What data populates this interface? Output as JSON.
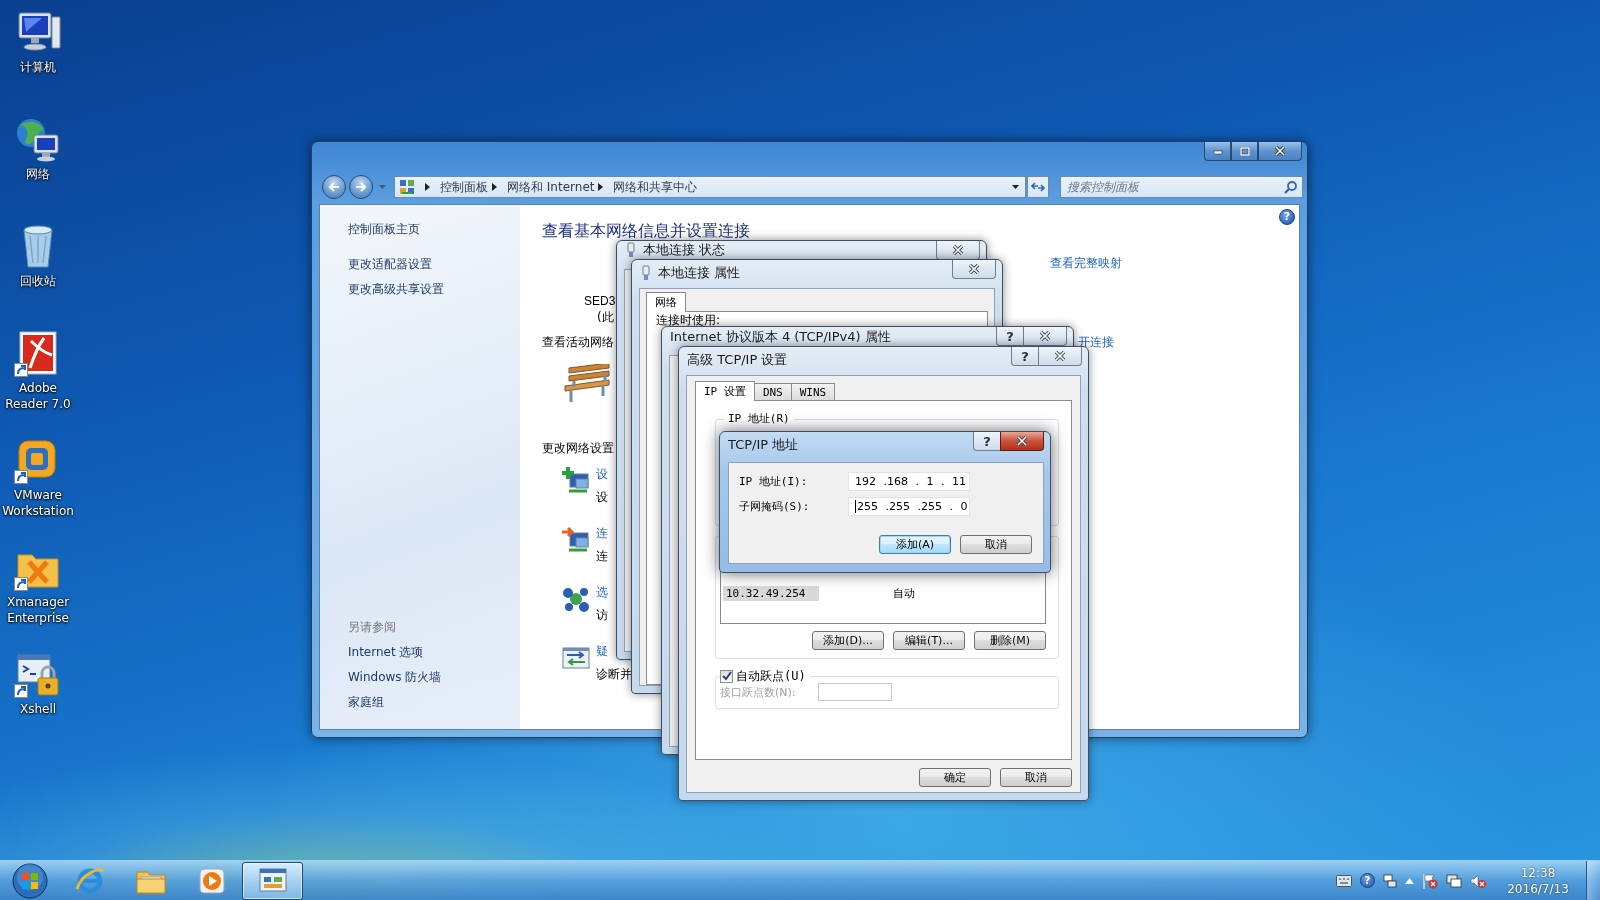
{
  "desktop_icons": [
    {
      "kind": "computer",
      "label": "计算机",
      "shortcut": false
    },
    {
      "kind": "network",
      "label": "网络",
      "shortcut": false
    },
    {
      "kind": "recycle-bin",
      "label": "回收站",
      "shortcut": false
    },
    {
      "kind": "pdf-reader",
      "label": "Adobe Reader 7.0",
      "shortcut": true
    },
    {
      "kind": "virtual-machine",
      "label": "VMware Workstation",
      "shortcut": true
    },
    {
      "kind": "xmanager",
      "label": "Xmanager Enterprise",
      "shortcut": true
    },
    {
      "kind": "terminal-lock",
      "label": "Xshell",
      "shortcut": true
    }
  ],
  "explorer": {
    "breadcrumb": [
      "控制面板",
      "网络和 Internet",
      "网络和共享中心"
    ],
    "search": {
      "placeholder": "搜索控制面板"
    },
    "help_button": "?",
    "sidebar": {
      "items": [
        "控制面板主页",
        "更改适配器设置",
        "更改高级共享设置"
      ],
      "see_also_title": "另请参阅",
      "see_also": [
        "Internet 选项",
        "Windows 防火墙",
        "家庭组"
      ]
    },
    "content": {
      "heading": "查看基本网络信息并设置连接",
      "map_link": "查看完整映射",
      "network_name": "SED3",
      "network_type": "(此",
      "active_networks_label": "查看活动网络",
      "connection_link": "开连接",
      "change_settings_label": "更改网络设置",
      "tasks": [
        {
          "kind": "add",
          "title": "设",
          "description": "设"
        },
        {
          "kind": "connect",
          "title": "连",
          "description": "连"
        },
        {
          "kind": "homegroup",
          "title": "选",
          "description": "访"
        },
        {
          "kind": "troubleshoot",
          "title": "疑",
          "description": "诊断并"
        }
      ]
    }
  },
  "status_dialog": {
    "title": "本地连接 状态"
  },
  "properties_dialog": {
    "title": "本地连接 属性",
    "tabs": [
      {
        "label": "网络",
        "selected": true
      }
    ],
    "connect_using_label": "连接时使用:"
  },
  "ipv4_dialog": {
    "title": "Internet 协议版本 4 (TCP/IPv4) 属性",
    "help_button": "?"
  },
  "advanced_dialog": {
    "title": "高级 TCP/IP 设置",
    "help_button": "?",
    "tabs": [
      {
        "label": "IP 设置",
        "selected": true
      },
      {
        "label": "DNS",
        "selected": false
      },
      {
        "label": "WINS",
        "selected": false
      }
    ],
    "ip_group_label": "IP 地址(R)",
    "gateways": [
      {
        "gateway": "10.32.49.254",
        "metric": "自动",
        "selected": true
      }
    ],
    "gateway_buttons": [
      "添加(D)...",
      "编辑(T)...",
      "删除(M)"
    ],
    "auto_metric": {
      "label": "自动跃点(U)",
      "checked": true
    },
    "interface_metric": {
      "label": "接口跃点数(N):",
      "disabled": true
    },
    "buttons": [
      "确定",
      "取消"
    ]
  },
  "address_dialog": {
    "title": "TCP/IP 地址",
    "help_button": "?",
    "fields": [
      {
        "label": "IP 地址(I):",
        "value": "192 .168 . 1 . 11",
        "focused": false
      },
      {
        "label": "子网掩码(S):",
        "value": "255 .255 .255 . 0",
        "focused": true
      }
    ],
    "buttons": [
      {
        "label": "添加(A)",
        "default": true
      },
      {
        "label": "取消",
        "default": false
      }
    ]
  },
  "taskbar": {
    "apps": [
      {
        "kind": "browser",
        "active": false
      },
      {
        "kind": "folder",
        "active": false
      },
      {
        "kind": "media-player",
        "active": false
      },
      {
        "kind": "control-panel",
        "active": true
      }
    ],
    "tray_help": "?",
    "clock": {
      "time": "12:38",
      "date": "2016/7/13"
    }
  }
}
